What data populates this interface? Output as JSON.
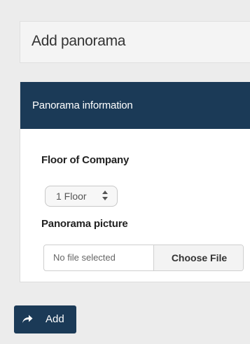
{
  "header": {
    "title": "Add panorama"
  },
  "panel": {
    "title": "Panorama information",
    "floor_label": "Floor of Company",
    "floor_select": {
      "value": "1 Floor"
    },
    "picture_label": "Panorama picture",
    "file_input": {
      "status": "No file selected",
      "button_label": "Choose File"
    }
  },
  "actions": {
    "add_label": "Add",
    "add_icon": "share-arrow-icon"
  },
  "colors": {
    "accent": "#1b3a57",
    "background": "#ececec"
  }
}
